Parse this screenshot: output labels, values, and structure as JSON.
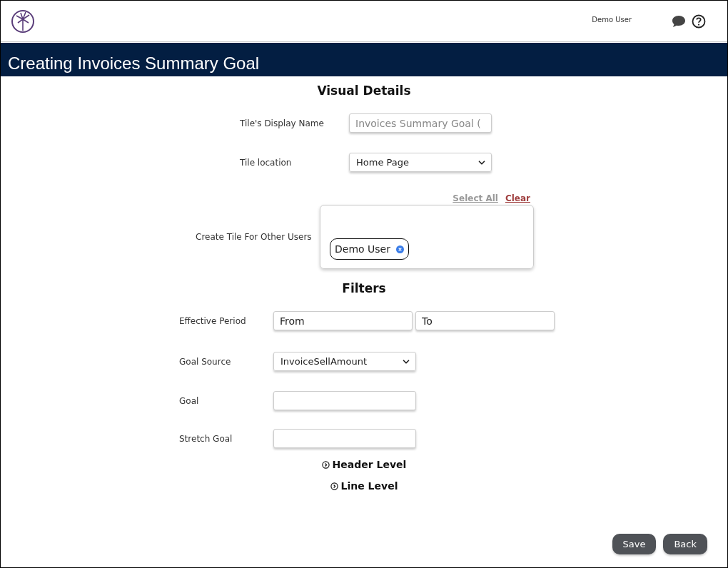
{
  "header": {
    "user_name": "Demo User"
  },
  "page_title": "Creating Invoices Summary Goal",
  "visual_details": {
    "heading": "Visual Details",
    "display_name": {
      "label": "Tile's Display Name",
      "placeholder": "Invoices Summary Goal ("
    },
    "tile_location": {
      "label": "Tile location",
      "value": "Home Page"
    },
    "other_users": {
      "label": "Create Tile For Other Users",
      "select_all": "Select All",
      "clear": "Clear",
      "chips": [
        "Demo User"
      ]
    }
  },
  "filters": {
    "heading": "Filters",
    "effective_period": {
      "label": "Effective Period",
      "from_placeholder": "From",
      "to_placeholder": "To"
    },
    "goal_source": {
      "label": "Goal Source",
      "value": "InvoiceSellAmount"
    },
    "goal": {
      "label": "Goal"
    },
    "stretch_goal": {
      "label": "Stretch Goal"
    },
    "sections": [
      {
        "label": "Header Level",
        "expanded": false
      },
      {
        "label": "Line Level",
        "expanded": false
      }
    ]
  },
  "buttons": [
    "Save",
    "Back"
  ]
}
